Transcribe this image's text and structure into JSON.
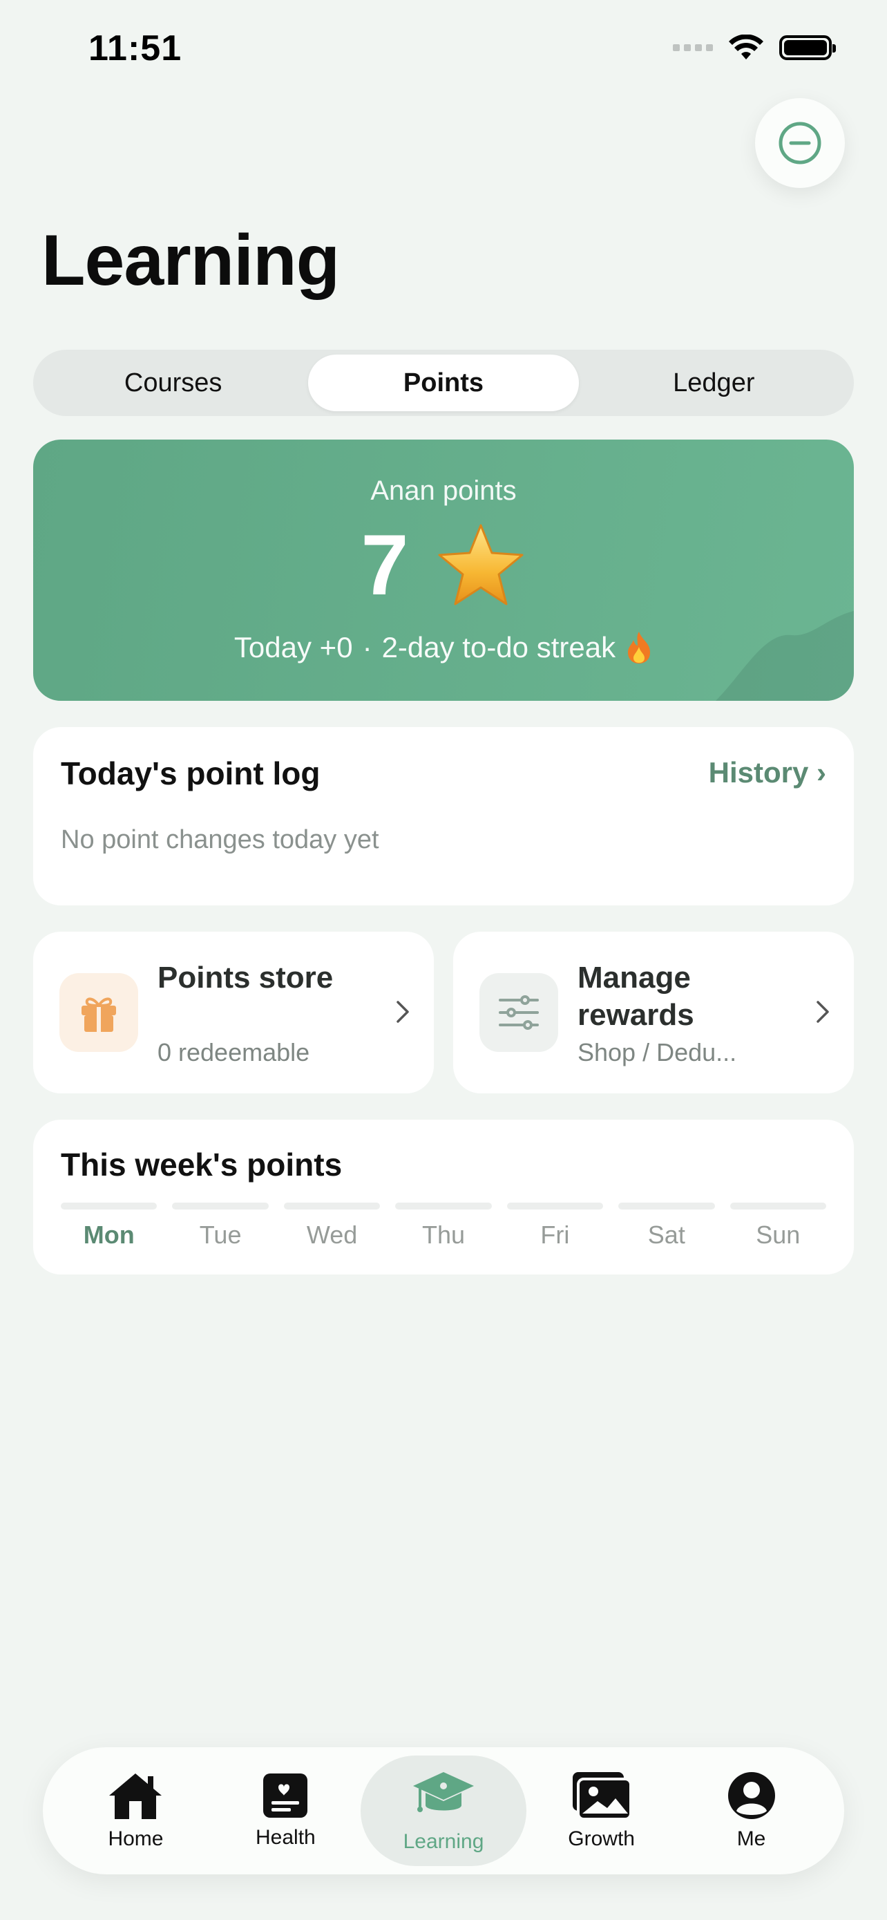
{
  "status_bar": {
    "time": "11:51"
  },
  "page": {
    "title": "Learning"
  },
  "segmented": {
    "tabs": [
      {
        "label": "Courses",
        "active": false
      },
      {
        "label": "Points",
        "active": true
      },
      {
        "label": "Ledger",
        "active": false
      }
    ]
  },
  "points_card": {
    "label": "Anan points",
    "value": "7",
    "today": "Today +0",
    "separator": "·",
    "streak": "2-day to-do streak",
    "streak_icon": "fire-emoji",
    "accent_color": "#64ae8b"
  },
  "point_log": {
    "title": "Today's point log",
    "history_label": "History ›",
    "empty_text": "No point changes today yet"
  },
  "tiles": {
    "store": {
      "title": "Points store",
      "subtitle": "0 redeemable",
      "icon": "gift-icon"
    },
    "manage": {
      "title": "Manage rewards",
      "subtitle": "Shop / Dedu...",
      "icon": "sliders-icon"
    }
  },
  "week": {
    "title": "This week's points",
    "days": [
      "Mon",
      "Tue",
      "Wed",
      "Thu",
      "Fri",
      "Sat",
      "Sun"
    ],
    "today_index": 0
  },
  "tabbar": {
    "items": [
      {
        "label": "Home",
        "icon": "home-icon"
      },
      {
        "label": "Health",
        "icon": "health-icon"
      },
      {
        "label": "Learning",
        "icon": "graduation-cap-icon",
        "active": true
      },
      {
        "label": "Growth",
        "icon": "photos-icon"
      },
      {
        "label": "Me",
        "icon": "person-icon"
      }
    ]
  }
}
